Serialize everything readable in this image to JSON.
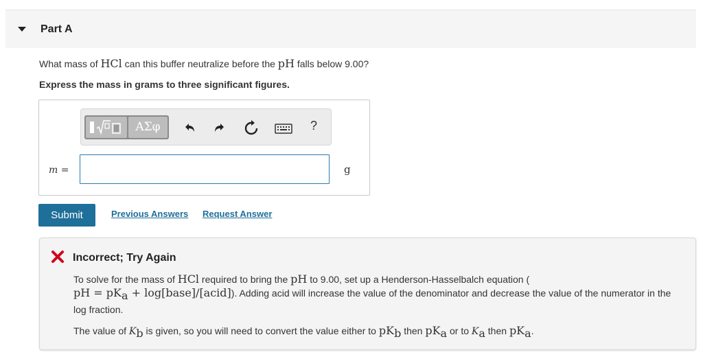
{
  "part": {
    "title": "Part A"
  },
  "question": {
    "prefix": "What mass of ",
    "species": "HCl",
    "middle": " can this buffer neutralize before the ",
    "ph": "pH",
    "suffix": " falls below 9.00?",
    "instruction": "Express the mass in grams to three significant figures."
  },
  "answer": {
    "variable": "m =",
    "input_value": "",
    "unit": "g",
    "toolbar": {
      "greek_label": "ΑΣφ",
      "help_label": "?"
    }
  },
  "actions": {
    "submit": "Submit",
    "previous_answers": "Previous Answers",
    "request_answer": "Request Answer"
  },
  "feedback": {
    "title": "Incorrect; Try Again",
    "p1_a": "To solve for the mass of ",
    "p1_hcl": "HCl",
    "p1_b": " required to bring the ",
    "p1_ph": "pH",
    "p1_c": " to 9.00, set up a Henderson-Hasselbalch equation (",
    "eq_ph": "pH",
    "eq_eq": " = ",
    "eq_pk": "pK",
    "eq_a": "a",
    "eq_plus": " + log[base]/[acid]",
    "p1_d": "). Adding acid will increase the value of the denominator and decrease the value of the numerator in the log fraction.",
    "p2_a": "The value of ",
    "p2_K": "K",
    "p2_b_sub": "b",
    "p2_b": " is given, so you will need to convert the value either to ",
    "p2_pK": "pK",
    "p2_c": " then ",
    "p2_d": " or to ",
    "p2_e": " then ",
    "p2_end": "."
  },
  "colors": {
    "accent": "#1e6f99",
    "error": "#d0021b",
    "input_border": "#2b7bb0"
  }
}
